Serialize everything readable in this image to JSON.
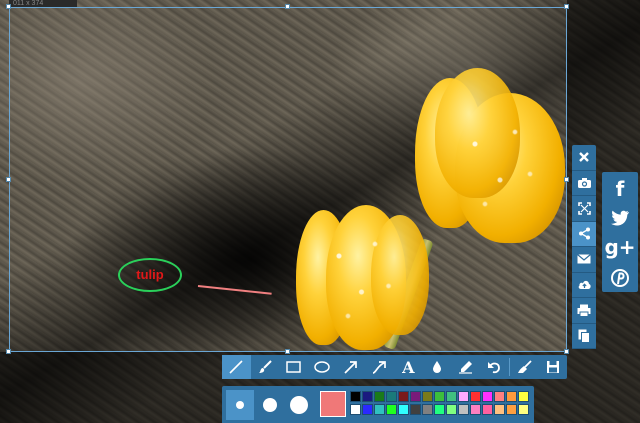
{
  "capture": {
    "size_label": "011 x 374"
  },
  "annotation": {
    "text": "tulip",
    "ellipse_color": "#2ad05a",
    "text_color": "#e01818",
    "line_color": "#f08080"
  },
  "side_toolbar": {
    "items": [
      {
        "name": "close-icon"
      },
      {
        "name": "camera-icon"
      },
      {
        "name": "fullscreen-icon"
      },
      {
        "name": "share-icon",
        "active": true
      },
      {
        "name": "email-icon"
      },
      {
        "name": "cloud-upload-icon"
      },
      {
        "name": "print-icon"
      },
      {
        "name": "copy-icon"
      }
    ]
  },
  "share_panel": {
    "items": [
      {
        "name": "facebook-icon",
        "glyph": "f"
      },
      {
        "name": "twitter-icon",
        "glyph": "🐦"
      },
      {
        "name": "google-plus-icon",
        "glyph": "g+"
      },
      {
        "name": "pinterest-icon",
        "glyph": "P"
      }
    ]
  },
  "tool_bar": {
    "items": [
      {
        "name": "line-tool-icon",
        "active": true
      },
      {
        "name": "brush-tool-icon"
      },
      {
        "name": "rectangle-tool-icon"
      },
      {
        "name": "ellipse-tool-icon"
      },
      {
        "name": "arrow-tool-icon"
      },
      {
        "name": "curved-arrow-tool-icon"
      },
      {
        "name": "text-tool-icon",
        "glyph": "A"
      },
      {
        "name": "blur-tool-icon"
      },
      {
        "name": "highlighter-tool-icon"
      },
      {
        "name": "undo-icon"
      },
      {
        "name": "clear-brush-icon"
      },
      {
        "name": "save-icon"
      }
    ]
  },
  "style_bar": {
    "current_color": "#f07878",
    "palette": [
      "#000000",
      "#1a1a80",
      "#1a7a1a",
      "#1a7a7a",
      "#7a1a1a",
      "#7a1a7a",
      "#7a7a1a",
      "#3cbf3c",
      "#40c080",
      "#ffaaff",
      "#ff3030",
      "#ff30ff",
      "#ff8080",
      "#ff9a3c",
      "#ffff40",
      "#ffffff",
      "#2a2aff",
      "#30c0c0",
      "#20ff20",
      "#30ffff",
      "#404040",
      "#808080",
      "#20ff80",
      "#80ff80",
      "#c0c0c0",
      "#ff80c0",
      "#ff60a0",
      "#ffc080",
      "#ffa040",
      "#ffff80"
    ]
  }
}
